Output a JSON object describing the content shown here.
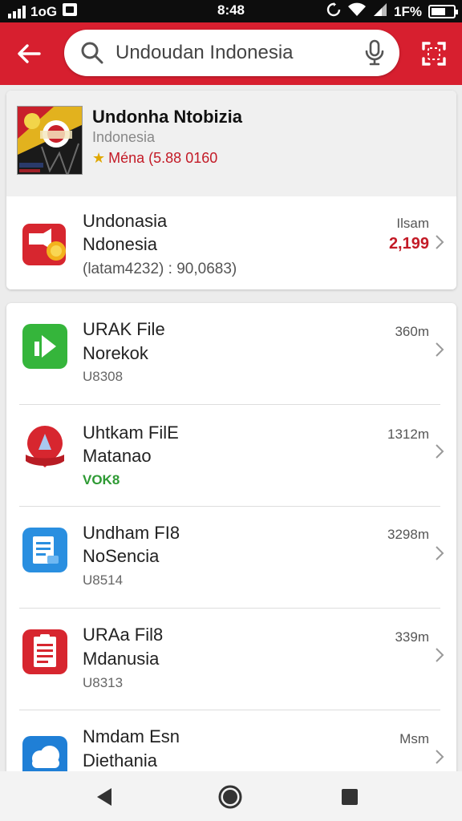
{
  "status_bar": {
    "network": "1oG",
    "carrier_icon": "sim-card-icon",
    "time": "8:48",
    "battery_text": "1F%",
    "battery_level": 0.65
  },
  "app_bar": {
    "back_icon": "arrow-left-icon",
    "search_text": "Undoudan Indonesia",
    "search_icon": "search-icon",
    "mic_icon": "mic-icon",
    "scan_icon": "scan-icon",
    "color": "#d71f2f"
  },
  "featured": {
    "title": "Undonha Ntobizia",
    "subtitle": "Indonesia",
    "rating_text": "Ména (5.88 0160"
  },
  "top_item": {
    "line1": "Undonasia",
    "line2": "Ndonesia",
    "line3": "(latam4232) : 90,0683)",
    "meta": "Ilsam",
    "meta_value": "2,199"
  },
  "items": [
    {
      "line1": "URAK File",
      "line2": "Norekok",
      "line3": "U8308",
      "meta": "360m",
      "icon": "green-play-icon",
      "line3_color": "#666666"
    },
    {
      "line1": "Uhtkam FilE",
      "line2": "Matanao",
      "line3": "VOK8",
      "meta": "1312m",
      "icon": "red-pin-icon",
      "line3_color": "#2e9a34"
    },
    {
      "line1": "Undham FI8",
      "line2": "NoSencia",
      "line3": "U8514",
      "meta": "3298m",
      "icon": "blue-doc-icon",
      "line3_color": "#666666"
    },
    {
      "line1": "URAa Fil8",
      "line2": "Mdanusia",
      "line3": "U8313",
      "meta": "339m",
      "icon": "red-doc-icon",
      "line3_color": "#666666"
    },
    {
      "line1": "Nmdam Esn",
      "line2": "Diethania",
      "line3": "",
      "meta": "Msm",
      "icon": "weather-cloud-icon",
      "line3_color": "#666666"
    }
  ],
  "nav": {
    "back": "nav-back-icon",
    "home": "nav-home-icon",
    "recents": "nav-recents-icon"
  }
}
